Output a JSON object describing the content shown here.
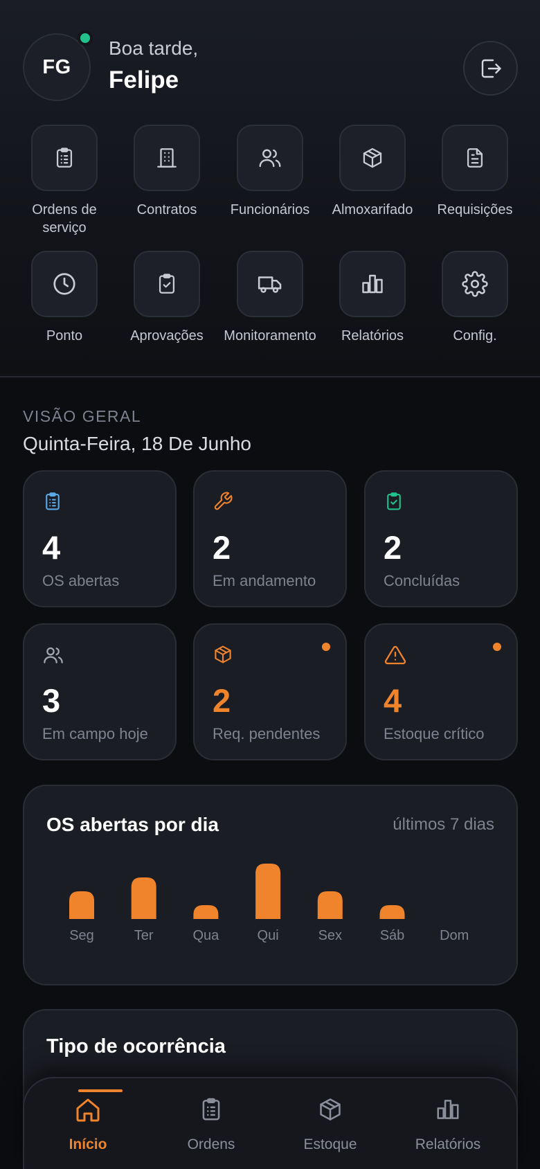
{
  "header": {
    "avatar_initials": "FG",
    "greeting": "Boa tarde,",
    "user_name": "Felipe",
    "logout_icon": "logout-icon"
  },
  "menu": [
    {
      "label": "Ordens de serviço",
      "icon": "clipboard-list-icon"
    },
    {
      "label": "Contratos",
      "icon": "building-icon"
    },
    {
      "label": "Funcionários",
      "icon": "users-icon"
    },
    {
      "label": "Almoxarifado",
      "icon": "package-icon"
    },
    {
      "label": "Requisições",
      "icon": "file-text-icon"
    },
    {
      "label": "Ponto",
      "icon": "clock-icon"
    },
    {
      "label": "Aprovações",
      "icon": "clipboard-check-icon"
    },
    {
      "label": "Monitoramento",
      "icon": "truck-icon"
    },
    {
      "label": "Relatórios",
      "icon": "bar-chart-icon"
    },
    {
      "label": "Config.",
      "icon": "gear-icon"
    }
  ],
  "overview": {
    "kicker": "VISÃO GERAL",
    "date": "Quinta-Feira, 18 De Junho"
  },
  "stats": [
    {
      "value": "4",
      "label": "OS abertas",
      "icon": "clipboard-list-icon",
      "color": "#5aa9e6",
      "alert": false
    },
    {
      "value": "2",
      "label": "Em andamento",
      "icon": "wrench-icon",
      "color": "#f0842c",
      "alert": false
    },
    {
      "value": "2",
      "label": "Concluídas",
      "icon": "clipboard-check-icon",
      "color": "#22c08a",
      "alert": false
    },
    {
      "value": "3",
      "label": "Em campo hoje",
      "icon": "users-icon",
      "color": "#a3a8b3",
      "alert": false
    },
    {
      "value": "2",
      "label": "Req. pendentes",
      "icon": "package-icon",
      "color": "#f0842c",
      "alert": true
    },
    {
      "value": "4",
      "label": "Estoque crítico",
      "icon": "warning-icon",
      "color": "#f0842c",
      "alert": true
    }
  ],
  "chart_card": {
    "title": "OS abertas por dia",
    "subtitle": "últimos 7 dias"
  },
  "chart_data": {
    "type": "bar",
    "categories": [
      "Seg",
      "Ter",
      "Qua",
      "Qui",
      "Sex",
      "Sáb",
      "Dom"
    ],
    "values": [
      2,
      3,
      1,
      4,
      2,
      1,
      0
    ],
    "ylim": [
      0,
      4
    ],
    "grid": false,
    "bar_color": "#f0842c"
  },
  "type_card": {
    "title": "Tipo de ocorrência"
  },
  "bottom_nav": [
    {
      "label": "Início",
      "icon": "home-icon",
      "active": true
    },
    {
      "label": "Ordens",
      "icon": "clipboard-list-icon",
      "active": false
    },
    {
      "label": "Estoque",
      "icon": "package-icon",
      "active": false
    },
    {
      "label": "Relatórios",
      "icon": "bar-chart-icon",
      "active": false
    }
  ],
  "colors": {
    "accent": "#f0842c",
    "online": "#22c08a",
    "muted": "#7e838f"
  }
}
